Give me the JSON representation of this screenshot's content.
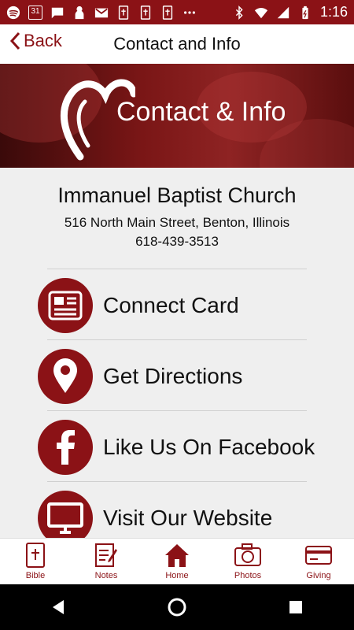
{
  "status_bar": {
    "time": "1:16",
    "calendar_day": "31",
    "icons_left": [
      "spotify-icon",
      "calendar-icon",
      "message-icon",
      "person-icon",
      "gmail-icon",
      "bible-icon",
      "bible-icon",
      "bible-icon",
      "more-icon"
    ],
    "icons_right": [
      "bluetooth-icon",
      "wifi-icon",
      "signal-icon",
      "battery-icon"
    ]
  },
  "nav": {
    "back_label": "Back",
    "title": "Contact and Info"
  },
  "hero": {
    "title": "Contact & Info"
  },
  "church": {
    "name": "Immanuel Baptist Church",
    "address": "516 North Main Street, Benton, Illinois",
    "phone": "618-439-3513"
  },
  "menu": [
    {
      "label": "Connect Card",
      "icon": "connect-card-icon"
    },
    {
      "label": "Get Directions",
      "icon": "map-pin-icon"
    },
    {
      "label": "Like Us On Facebook",
      "icon": "facebook-icon"
    },
    {
      "label": "Visit Our Website",
      "icon": "monitor-icon"
    }
  ],
  "tabs": [
    {
      "label": "Bible",
      "icon": "bible-icon"
    },
    {
      "label": "Notes",
      "icon": "notes-icon"
    },
    {
      "label": "Home",
      "icon": "home-icon"
    },
    {
      "label": "Photos",
      "icon": "camera-icon"
    },
    {
      "label": "Giving",
      "icon": "credit-card-icon"
    }
  ],
  "colors": {
    "accent": "#8b1216",
    "background": "#efefef"
  }
}
